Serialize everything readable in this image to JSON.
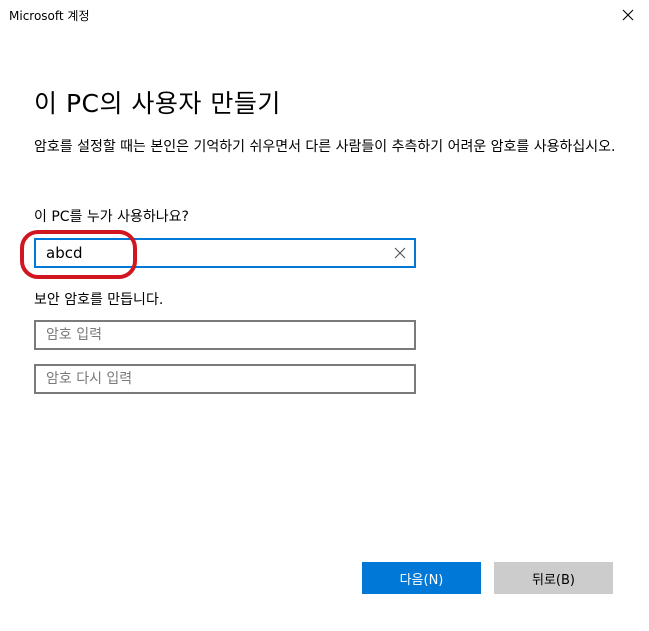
{
  "window": {
    "title": "Microsoft 계정",
    "close_icon": "close-icon"
  },
  "page": {
    "title": "이 PC의 사용자 만들기",
    "description": "암호를 설정할 때는 본인은 기억하기 쉬우면서 다른 사람들이 추측하기 어려운 암호를 사용하십시오.",
    "username_question": "이 PC를 누가 사용하나요?",
    "username_value": "abcd",
    "clear_icon": "clear-x-icon",
    "password_label": "보안 암호를 만듭니다.",
    "password_placeholder": "암호 입력",
    "password_confirm_placeholder": "암호 다시 입력"
  },
  "buttons": {
    "next_label": "다음(N)",
    "back_label": "뒤로(B)"
  },
  "colors": {
    "accent": "#0078d7",
    "highlight_ring": "#d11521",
    "back_button": "#cccccc"
  }
}
